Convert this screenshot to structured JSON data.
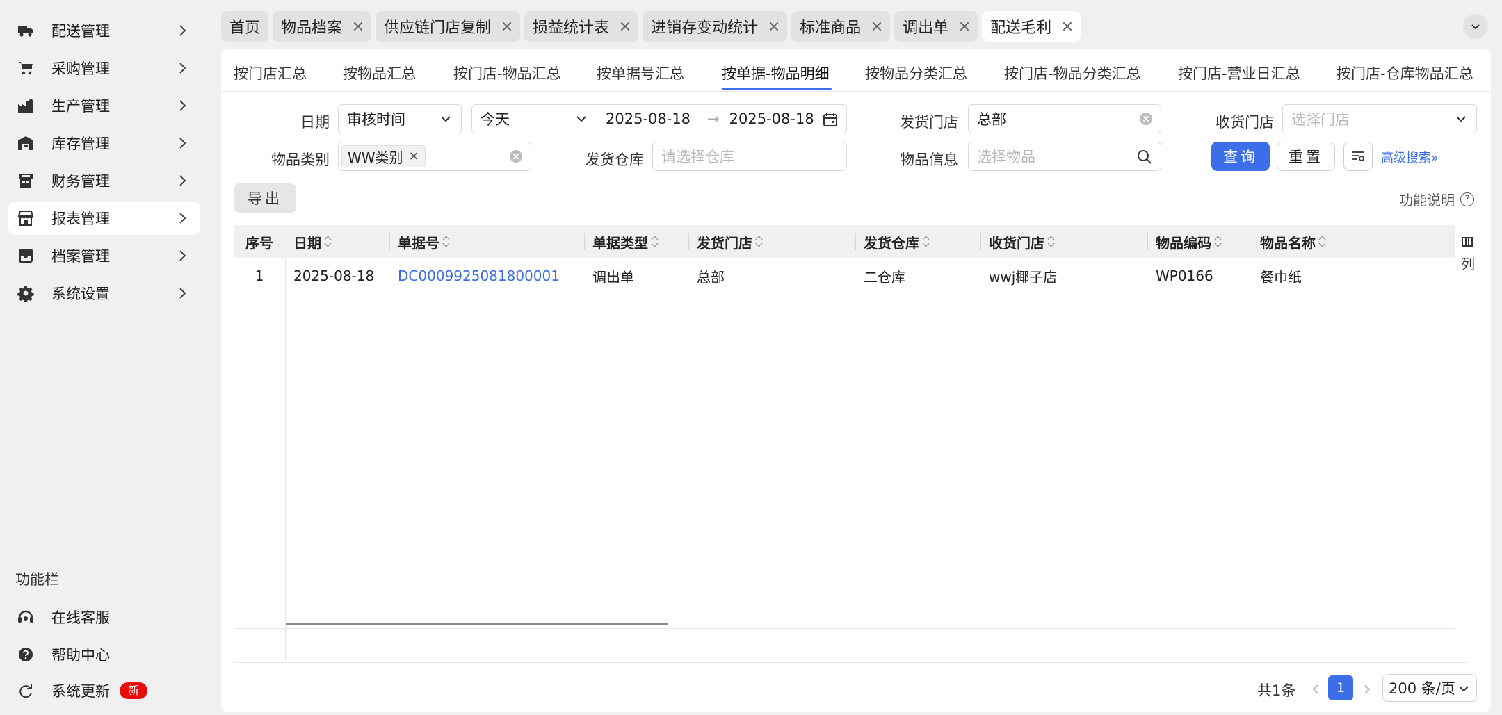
{
  "sidebar": {
    "items": [
      {
        "label": "配送管理",
        "icon": "truck-icon"
      },
      {
        "label": "采购管理",
        "icon": "cart-icon"
      },
      {
        "label": "生产管理",
        "icon": "factory-icon"
      },
      {
        "label": "库存管理",
        "icon": "warehouse-icon"
      },
      {
        "label": "财务管理",
        "icon": "cash-register-icon"
      },
      {
        "label": "报表管理",
        "icon": "report-store-icon",
        "active": true
      },
      {
        "label": "档案管理",
        "icon": "inbox-icon"
      },
      {
        "label": "系统设置",
        "icon": "gear-icon"
      }
    ],
    "section_title": "功能栏",
    "bottom": [
      {
        "label": "在线客服",
        "icon": "headset-icon"
      },
      {
        "label": "帮助中心",
        "icon": "help-circle-icon"
      },
      {
        "label": "系统更新",
        "icon": "refresh-icon",
        "badge": "新"
      }
    ]
  },
  "tabs": [
    {
      "label": "首页",
      "closable": false
    },
    {
      "label": "物品档案",
      "closable": true
    },
    {
      "label": "供应链门店复制",
      "closable": true
    },
    {
      "label": "损益统计表",
      "closable": true
    },
    {
      "label": "进销存变动统计",
      "closable": true
    },
    {
      "label": "标准商品",
      "closable": true
    },
    {
      "label": "调出单",
      "closable": true
    },
    {
      "label": "配送毛利",
      "closable": true,
      "active": true
    }
  ],
  "subtabs": [
    "按门店汇总",
    "按物品汇总",
    "按门店-物品汇总",
    "按单据号汇总",
    "按单据-物品明细",
    "按物品分类汇总",
    "按门店-物品分类汇总",
    "按门店-营业日汇总",
    "按门店-仓库物品汇总"
  ],
  "active_subtab_index": 4,
  "filters": {
    "date_label": "日期",
    "date_type": "审核时间",
    "date_range_preset": "今天",
    "date_start": "2025-08-18",
    "date_end": "2025-08-18",
    "range_arrow": "→",
    "ship_store_label": "发货门店",
    "ship_store_value": "总部",
    "receive_store_label": "收货门店",
    "receive_store_placeholder": "选择门店",
    "category_label": "物品类别",
    "category_chip": "WW类别",
    "ship_wh_label": "发货仓库",
    "ship_wh_placeholder": "请选择仓库",
    "item_label": "物品信息",
    "item_placeholder": "选择物品",
    "query_btn": "查询",
    "reset_btn": "重置",
    "advanced": "高级搜索"
  },
  "toolbar": {
    "export": "导出",
    "help": "功能说明",
    "help_icon": "?"
  },
  "table": {
    "headers": [
      "序号",
      "日期",
      "单据号",
      "单据类型",
      "发货门店",
      "发货仓库",
      "收货门店",
      "物品编码",
      "物品名称"
    ],
    "rows": [
      {
        "seq": "1",
        "date": "2025-08-18",
        "doc_no": "DC0009925081800001",
        "doc_type": "调出单",
        "ship_store": "总部",
        "ship_wh": "二仓库",
        "recv_store": "wwj椰子店",
        "item_code": "WP0166",
        "item_name": "餐巾纸"
      }
    ],
    "columns_label": "列"
  },
  "pagination": {
    "total": "共1条",
    "current": "1",
    "page_size": "200 条/页"
  },
  "colors": {
    "primary": "#3c6ee8",
    "badge": "#e80d0d"
  }
}
